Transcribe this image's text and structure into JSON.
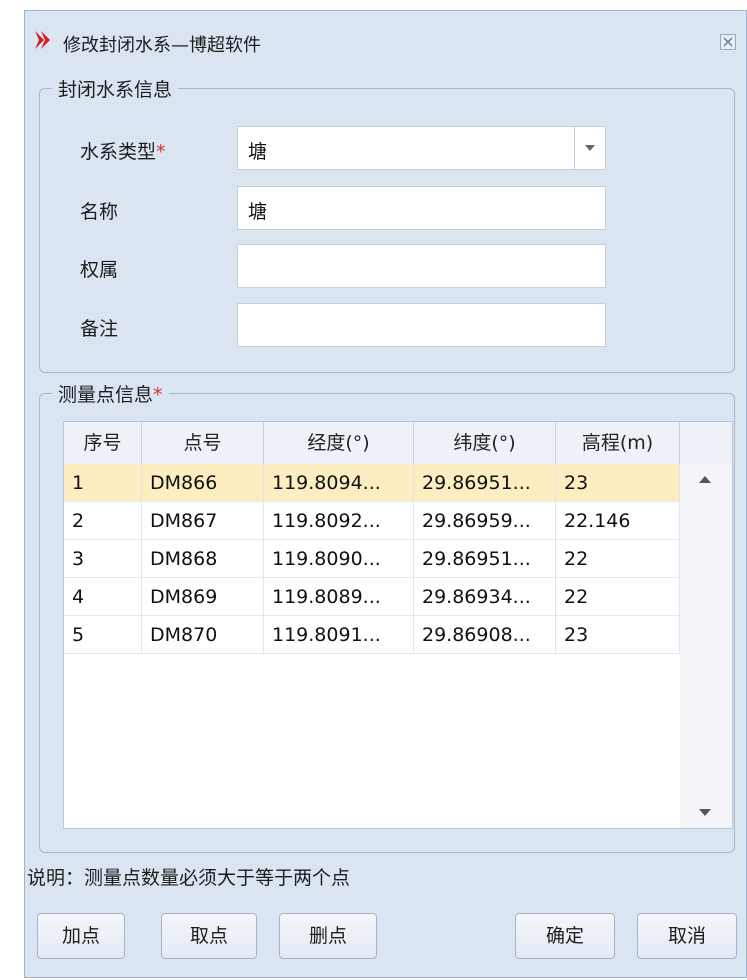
{
  "window": {
    "title": "修改封闭水系—博超软件"
  },
  "group_info": {
    "legend": "封闭水系信息",
    "fields": {
      "type_label": "水系类型",
      "type_required": "*",
      "type_value": "塘",
      "name_label": "名称",
      "name_value": "塘",
      "owner_label": "权属",
      "owner_value": "",
      "remark_label": "备注",
      "remark_value": ""
    }
  },
  "group_points": {
    "legend": "测量点信息",
    "required": "*",
    "columns": [
      "序号",
      "点号",
      "经度(°)",
      "纬度(°)",
      "高程(m)"
    ],
    "rows": [
      [
        "1",
        "DM866",
        "119.8094...",
        "29.86951...",
        "23"
      ],
      [
        "2",
        "DM867",
        "119.8092...",
        "29.86959...",
        "22.146"
      ],
      [
        "3",
        "DM868",
        "119.8090...",
        "29.86951...",
        "22"
      ],
      [
        "4",
        "DM869",
        "119.8089...",
        "29.86934...",
        "22"
      ],
      [
        "5",
        "DM870",
        "119.8091...",
        "29.86908...",
        "23"
      ]
    ],
    "selected_row": 1
  },
  "note": "说明：测量点数量必须大于等于两个点",
  "buttons": {
    "add_point": "加点",
    "pick_point": "取点",
    "delete_point": "删点",
    "ok": "确定",
    "cancel": "取消"
  },
  "colors": {
    "selected_row": "#fdeec2",
    "required": "#d93030",
    "icon": "#d42020"
  }
}
